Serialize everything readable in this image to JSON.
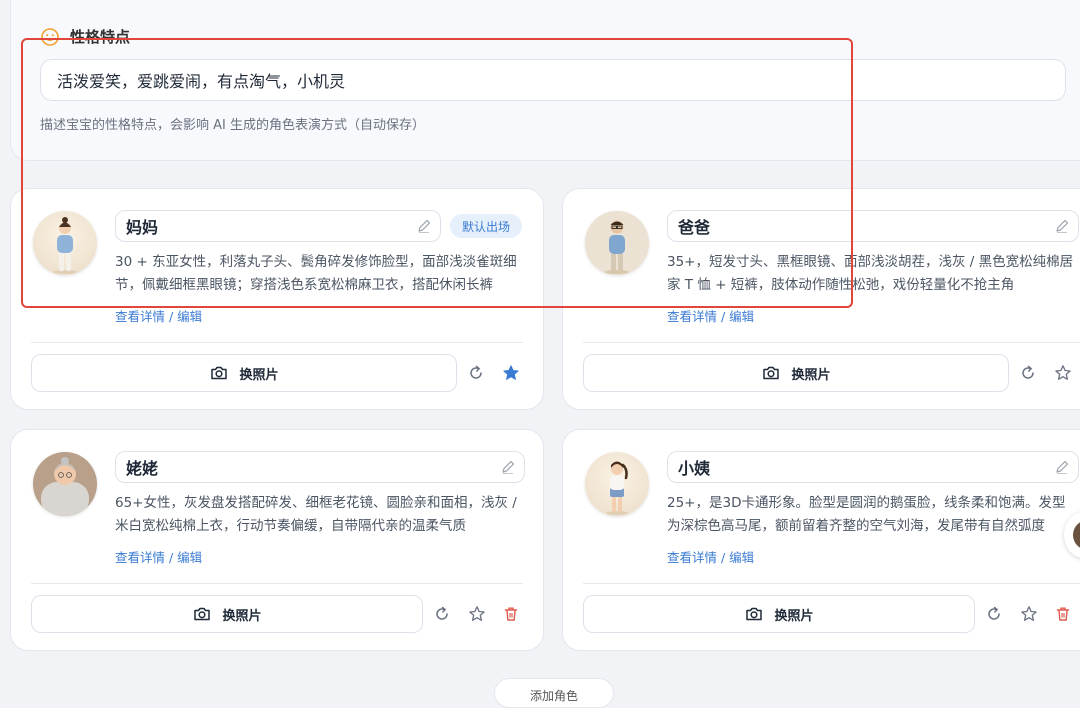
{
  "personality": {
    "title": "性格特点",
    "value": "活泼爱笑，爱跳爱闹，有点淘气，小机灵",
    "helper": "描述宝宝的性格特点，会影响 AI 生成的角色表演方式（自动保存）"
  },
  "cards": [
    {
      "name": "妈妈",
      "badge": "默认出场",
      "description": "30 + 东亚女性，利落丸子头、鬓角碎发修饰脸型，面部浅淡雀斑细节，佩戴细框黑眼镜；穿搭浅色系宽松棉麻卫衣，搭配休闲长裤",
      "detail_link": "查看详情 / 编辑",
      "photo_button": "换照片"
    },
    {
      "name": "爸爸",
      "description": "35+，短发寸头、黑框眼镜、面部浅淡胡茬，浅灰 / 黑色宽松纯棉居家 T 恤 + 短裤，肢体动作随性松弛，戏份轻量化不抢主角",
      "detail_link": "查看详情 / 编辑",
      "photo_button": "换照片"
    },
    {
      "name": "姥姥",
      "description": "65+女性，灰发盘发搭配碎发、细框老花镜、圆脸亲和面相，浅灰 / 米白宽松纯棉上衣，行动节奏偏缓，自带隔代亲的温柔气质",
      "detail_link": "查看详情 / 编辑",
      "photo_button": "换照片"
    },
    {
      "name": "小姨",
      "description": "25+，是3D卡通形象。脸型是圆润的鹅蛋脸，线条柔和饱满。发型为深棕色高马尾，额前留着齐整的空气刘海，发尾带有自然弧度",
      "detail_link": "查看详情 / 编辑",
      "photo_button": "换照片"
    }
  ],
  "bottom_button": "添加角色",
  "colors": {
    "accent": "#3b7bd4",
    "highlight_frame": "#e0473a",
    "delete": "#e05a4f",
    "star_filled": "#3b7bd4"
  },
  "icons": [
    "smile-icon",
    "pencil-icon",
    "camera-icon",
    "refresh-icon",
    "star-icon",
    "trash-icon"
  ]
}
